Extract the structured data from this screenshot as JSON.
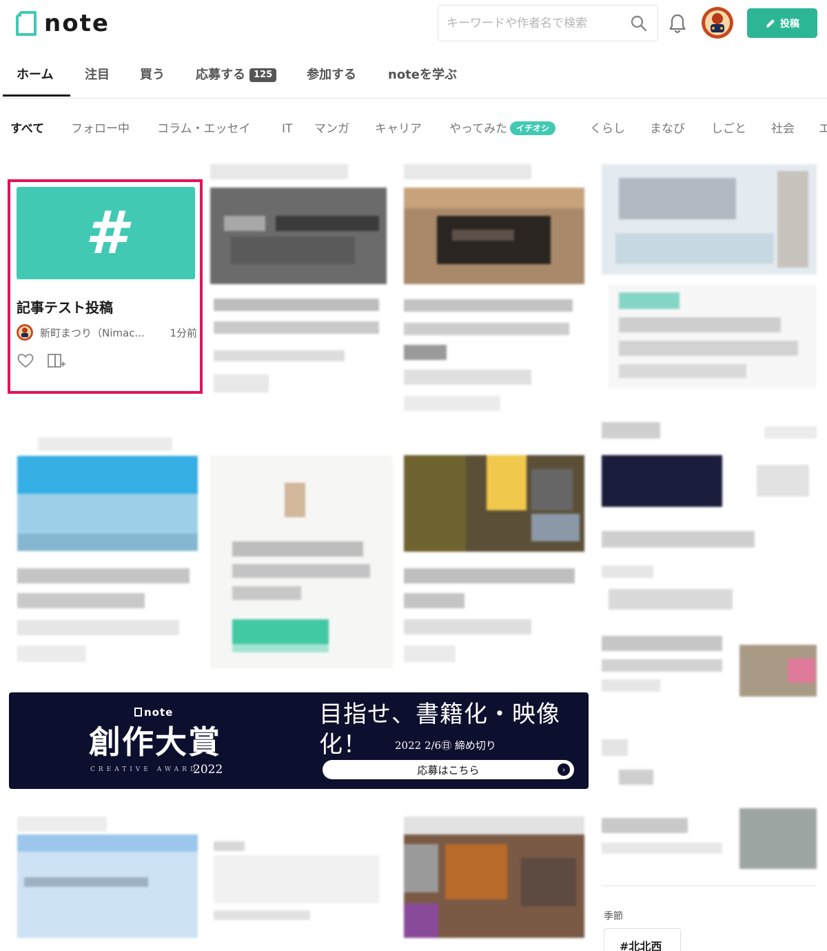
{
  "header": {
    "logo_text": "note",
    "search_placeholder": "キーワードや作者名で検索",
    "post_label": "投稿"
  },
  "tabs": [
    {
      "label": "ホーム",
      "active": true
    },
    {
      "label": "注目"
    },
    {
      "label": "買う"
    },
    {
      "label": "応募する",
      "badge": "125"
    },
    {
      "label": "参加する"
    },
    {
      "label": "noteを学ぶ"
    }
  ],
  "categories": [
    {
      "label": "すべて",
      "active": true
    },
    {
      "label": "フォロー中"
    },
    {
      "label": "コラム・エッセイ"
    },
    {
      "label": "IT"
    },
    {
      "label": "マンガ"
    },
    {
      "label": "キャリア"
    },
    {
      "label": "やってみた",
      "badge": "イチオシ"
    },
    {
      "label": "くらし"
    },
    {
      "label": "まなび"
    },
    {
      "label": "しごと"
    },
    {
      "label": "社会"
    },
    {
      "label": "エ"
    }
  ],
  "featured_card": {
    "thumb_symbol": "#",
    "title": "記事テスト投稿",
    "author": "新町まつり（Nimac...",
    "time": "1分前"
  },
  "banner": {
    "logo": "note",
    "title": "創作大賞",
    "subtitle": "CREATIVE AWARD",
    "year": "2022",
    "headline": "目指せ、書籍化・映像化！",
    "deadline": "2022 2/6㊐ 締め切り",
    "button": "応募はこちら"
  },
  "sidebar": {
    "season_label": "季節",
    "hashtag": "#北北西"
  },
  "colors": {
    "brand": "#41c9b4",
    "post_button": "#2cb696",
    "highlight_border": "#e3125b",
    "banner_bg": "#0d0f2e"
  }
}
